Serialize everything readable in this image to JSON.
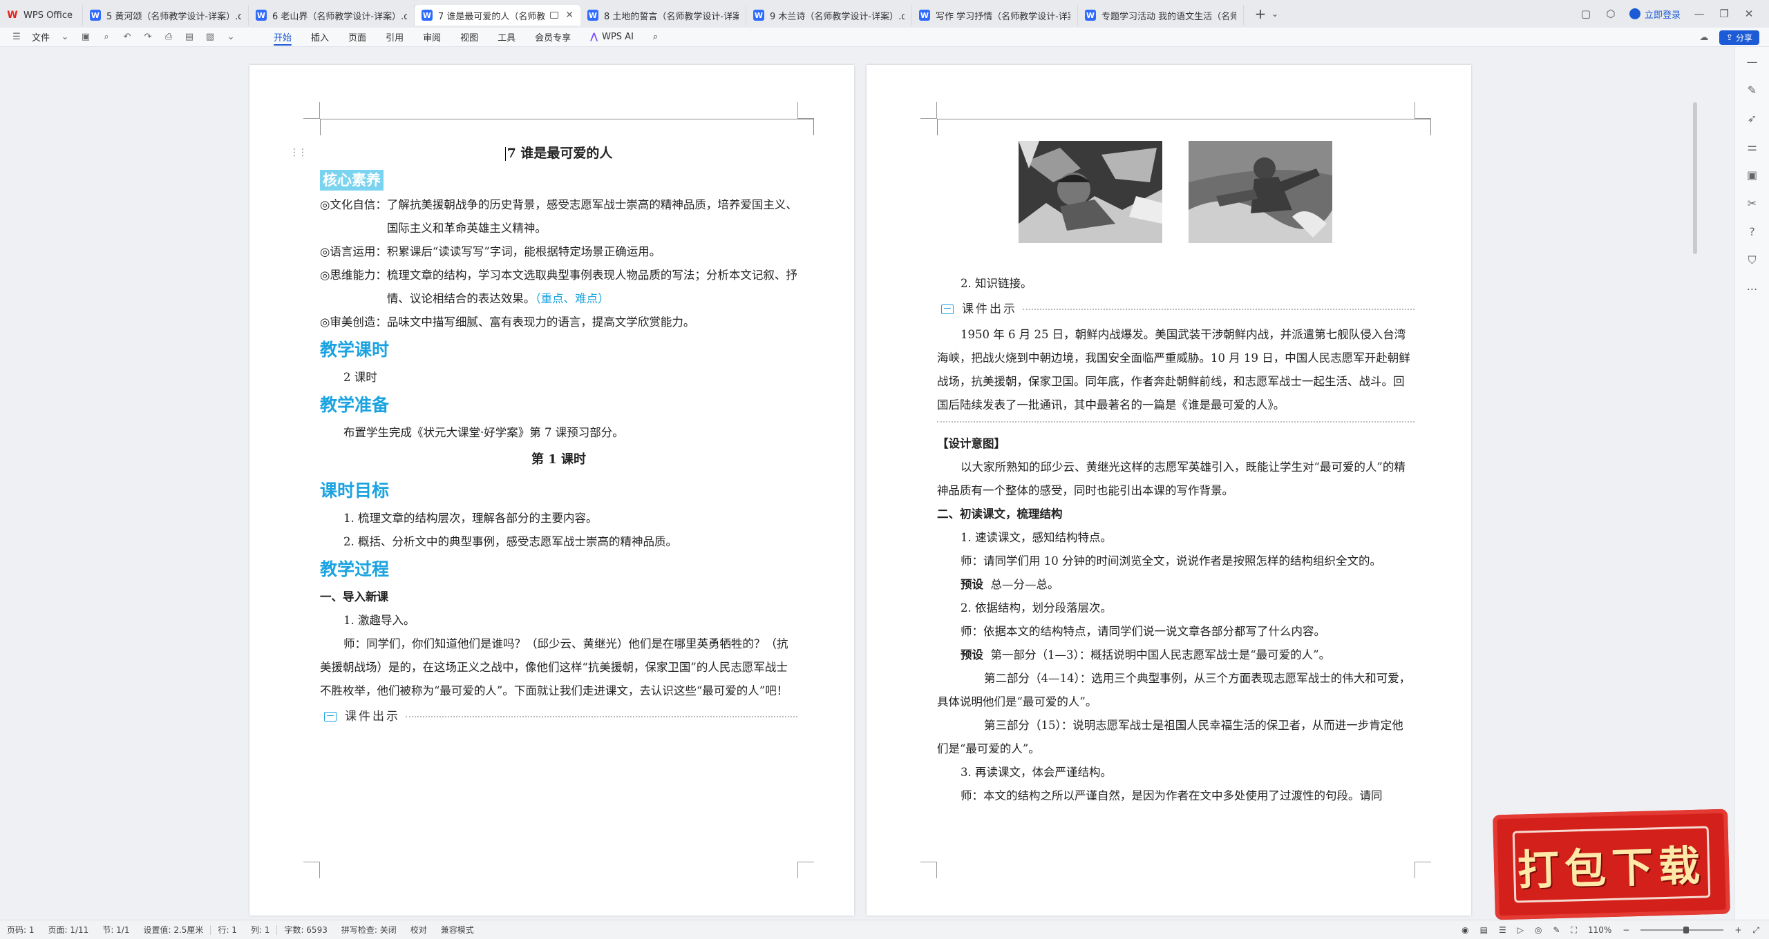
{
  "tabs": [
    {
      "label": "WPS Office",
      "type": "home"
    },
    {
      "label": "5 黄河颂（名师教学设计-详案）.doc",
      "type": "doc"
    },
    {
      "label": "6 老山界（名师教学设计-详案）.doc",
      "type": "doc"
    },
    {
      "label": "7 谁是最可爱的人（名师教学",
      "type": "doc",
      "active": true
    },
    {
      "label": "8 土地的誓言（名师教学设计-详案）",
      "type": "doc"
    },
    {
      "label": "9 木兰诗（名师教学设计-详案）.doc",
      "type": "doc"
    },
    {
      "label": "写作 学习抒情（名师教学设计-详案）",
      "type": "doc"
    },
    {
      "label": "专题学习活动 我的语文生活（名师教",
      "type": "doc"
    }
  ],
  "titlebar": {
    "login_label": "立即登录"
  },
  "ribbon": {
    "file_label": "文件",
    "menu": [
      "开始",
      "插入",
      "页面",
      "引用",
      "审阅",
      "视图",
      "工具",
      "会员专享"
    ],
    "active_menu": "开始",
    "ai_label": "WPS AI",
    "share_label": "分享"
  },
  "page1": {
    "title": "7  谁是最可爱的人",
    "core_heading": "核心素养",
    "core_items": [
      {
        "key": "◎文化自信：",
        "value": "了解抗美援朝战争的历史背景，感受志愿军战士崇高的精神品质，培养爱国主义、国际主义和革命英雄主义精神。"
      },
      {
        "key": "◎语言运用：",
        "value": "积累课后“读读写写”字词，能根据特定场景正确运用。"
      },
      {
        "key": "◎思维能力：",
        "value": "梳理文章的结构，学习本文选取典型事例表现人物品质的写法；分析本文记叙、抒情、议论相结合的表达效果。",
        "highlight": "（重点、难点）"
      },
      {
        "key": "◎审美创造：",
        "value": "品味文中描写细腻、富有表现力的语言，提高文学欣赏能力。"
      }
    ],
    "hours_heading": "教学课时",
    "hours_value": "2 课时",
    "prep_heading": "教学准备",
    "prep_value": "布置学生完成《状元大课堂·好学案》第 7 课预习部分。",
    "lesson1": "第 1 课时",
    "goals_heading": "课时目标",
    "goals": [
      "1. 梳理文章的结构层次，理解各部分的主要内容。",
      "2. 概括、分析文中的典型事例，感受志愿军战士崇高的精神品质。"
    ],
    "process_heading": "教学过程",
    "process_sub": "一、导入新课",
    "process_item": "1. 激趣导入。",
    "process_para": "师：同学们，你们知道他们是谁吗？（邱少云、黄继光）他们是在哪里英勇牺牲的？（抗美援朝战场）是的，在这场正义之战中，像他们这样“抗美援朝，保家卫国”的人民志愿军战士不胜枚举，他们被称为“最可爱的人”。下面就让我们走进课文，去认识这些“最可爱的人”吧！",
    "courseware": "课件出示"
  },
  "page2": {
    "item2": "2. 知识链接。",
    "courseware": "课件出示",
    "background_para": "1950 年 6 月 25 日，朝鲜内战爆发。美国武装干涉朝鲜内战，并派遣第七舰队侵入台湾海峡，把战火烧到中朝边境，我国安全面临严重威胁。10 月 19 日，中国人民志愿军开赴朝鲜战场，抗美援朝，保家卫国。同年底，作者奔赴朝鲜前线，和志愿军战士一起生活、战斗。回国后陆续发表了一批通讯，其中最著名的一篇是《谁是最可爱的人》。",
    "design_heading": "【设计意图】",
    "design_para": "以大家所熟知的邱少云、黄继光这样的志愿军英雄引入，既能让学生对“最可爱的人”的精神品质有一个整体的感受，同时也能引出本课的写作背景。",
    "section2": "二、初读课文，梳理结构",
    "s2_item1": "1. 速读课文，感知结构特点。",
    "s2_q1": "师：请同学们用 10 分钟的时间浏览全文，说说作者是按照怎样的结构组织全文的。",
    "yushe_label": "预设",
    "s2_a1": "总—分—总。",
    "s2_item2": "2. 依据结构，划分段落层次。",
    "s2_q2": "师：依据本文的结构特点，请同学们说一说文章各部分都写了什么内容。",
    "s2_a2": "第一部分（1—3）：概括说明中国人民志愿军战士是“最可爱的人”。",
    "s2_a2b": "第二部分（4—14）：选用三个典型事例，从三个方面表现志愿军战士的伟大和可爱，具体说明他们是“最可爱的人”。",
    "s2_a2c": "第三部分（15）：说明志愿军战士是祖国人民幸福生活的保卫者，从而进一步肯定他们是“最可爱的人”。",
    "s2_item3": "3. 再读课文，体会严谨结构。",
    "s2_q3": "师：本文的结构之所以严谨自然，是因为作者在文中多处使用了过渡性的句段。请同"
  },
  "statusbar": {
    "page": "页码: 1",
    "pages": "页面: 1/11",
    "section": "节: 1/1",
    "setting": "设置值: 2.5厘米",
    "row": "行: 1",
    "col": "列: 1",
    "words": "字数: 6593",
    "spell": "拼写检查: 关闭",
    "proof": "校对",
    "compat": "兼容模式",
    "zoom": "110%",
    "zoom_fraction": 0.55
  },
  "download_badge": "打包下载"
}
